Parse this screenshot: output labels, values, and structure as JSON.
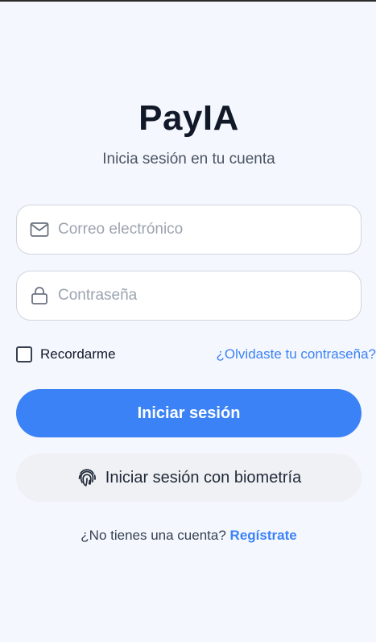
{
  "app": {
    "title": "PayIA",
    "subtitle": "Inicia sesión en tu cuenta"
  },
  "form": {
    "email": {
      "placeholder": "Correo electrónico",
      "value": "",
      "icon": "mail-icon"
    },
    "password": {
      "placeholder": "Contraseña",
      "value": "",
      "icon": "lock-icon"
    },
    "remember_label": "Recordarme",
    "remember_checked": false,
    "forgot_label": "¿Olvidaste tu contraseña?"
  },
  "buttons": {
    "login_label": "Iniciar sesión",
    "biometric_label": "Iniciar sesión con biometría",
    "biometric_icon": "fingerprint-icon"
  },
  "signup": {
    "prompt": "¿No tienes una cuenta?",
    "link_label": "Regístrate"
  },
  "colors": {
    "accent": "#3b82f6",
    "background": "#f5f7fe",
    "secondary_button": "#f0f1f5"
  }
}
